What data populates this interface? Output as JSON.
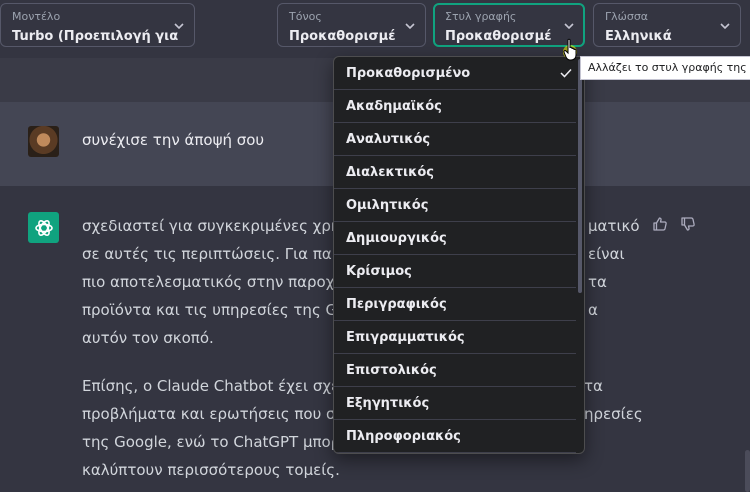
{
  "toolbar": {
    "model": {
      "caption": "Μοντέλο",
      "value": "Turbo (Προεπιλογή για"
    },
    "tone": {
      "caption": "Τόνος",
      "value": "Προκαθορισμέ"
    },
    "style": {
      "caption": "Στυλ γραφής",
      "value": "Προκαθορισμέ"
    },
    "language": {
      "caption": "Γλώσσα",
      "value": "Ελληνικά"
    }
  },
  "tooltip": "Αλλάζει το στυλ γραφής της ο",
  "user_message": "συνέχισε την άποψή σου",
  "assistant": {
    "paragraph1": [
      "σχεδιαστεί για συγκεκριμένες χρήσ",
      "σε αυτές τις περιπτώσεις. Για παράδ",
      "πιο αποτελεσματικός στην παροχή",
      "προϊόντα και τις υπηρεσίες της Goo",
      "αυτόν τον σκοπό."
    ],
    "paragraph1_right": [
      "ματικό",
      "είναι",
      "τα",
      "α",
      ""
    ],
    "paragraph2": [
      "Επίσης, ο Claude Chatbot έχει σχεδι",
      "προβλήματα και ερωτήσεις που σχε",
      "της Google, ενώ το ChatGPT μπορεί",
      "καλύπτουν περισσότερους τομείς."
    ],
    "paragraph2_right": [
      "τα",
      "ηρεσίες",
      "",
      ""
    ]
  },
  "dropdown": {
    "selected": "Προκαθορισμένο",
    "options": [
      "Προκαθορισμένο",
      "Ακαδημαϊκός",
      "Αναλυτικός",
      "Διαλεκτικός",
      "Ομιλητικός",
      "Δημιουργικός",
      "Κρίσιμος",
      "Περιγραφικός",
      "Επιγραμματικός",
      "Επιστολικός",
      "Εξηγητικός",
      "Πληροφοριακός"
    ]
  },
  "icons": {
    "chevron": "chevron-down-icon",
    "check": "check-icon",
    "thumb_up": "thumbs-up-icon",
    "thumb_down": "thumbs-down-icon",
    "logo": "openai-logo-icon",
    "cursor": "hand-pointer-cursor-icon"
  },
  "colors": {
    "background": "#343541",
    "user_row": "#444654",
    "accent": "#10a37f",
    "dropdown_bg": "#202123"
  }
}
